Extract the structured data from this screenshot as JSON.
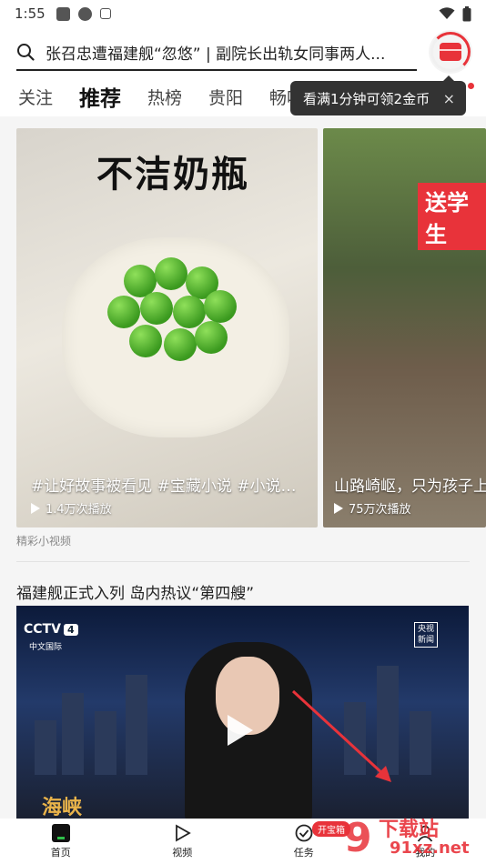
{
  "status_bar": {
    "time": "1:55"
  },
  "search": {
    "query": "张召忠遭福建舰“忽悠” | 副院长出轨女同事两人..."
  },
  "tabs": [
    {
      "label": "关注"
    },
    {
      "label": "推荐"
    },
    {
      "label": "热榜"
    },
    {
      "label": "贵阳"
    },
    {
      "label": "畅听"
    }
  ],
  "tooltip": {
    "text": "看满1分钟可领2金币",
    "close": "×"
  },
  "video_cards": [
    {
      "cover_text": "不洁奶瓶",
      "title": "#让好故事被看见 #宝藏小说 #小说推...",
      "plays": "1.4万次播放"
    },
    {
      "cover_text": "送学生",
      "title": "山路崎岖，只为孩子上学",
      "plays": "75万次播放"
    }
  ],
  "section_label": "精彩小视频",
  "news": {
    "title": "福建舰正式入列 岛内热议“第四艘”",
    "channel_logo": "CCTV",
    "channel_number": "4",
    "channel_name": "中文国际",
    "corner_logo_line1": "央视",
    "corner_logo_line2": "新闻",
    "bottom_caption": "海峡"
  },
  "bottom_nav": [
    {
      "label": "首页",
      "icon": "home-icon"
    },
    {
      "label": "视频",
      "icon": "play-icon"
    },
    {
      "label": "任务",
      "icon": "check-circle-icon",
      "badge": "开宝箱"
    },
    {
      "label": "我的",
      "icon": "person-icon"
    }
  ],
  "watermark": {
    "line1": "下载站",
    "line2": "91xz.net"
  },
  "colors": {
    "accent": "#e8333a",
    "text": "#222222"
  }
}
